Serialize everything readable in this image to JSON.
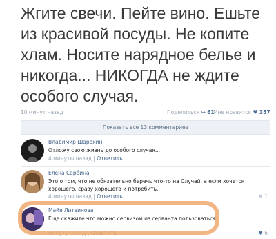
{
  "post": {
    "text": "Жгите свечи. Пейте вино. Ешьте\nиз красивой посуды. Не копите\nхлам. Носите нарядное белье и\nникогда... НИКОГДА не ждите\nособого случая.",
    "time": "10 минут назад",
    "share_label": "Поделиться",
    "share_count": "61",
    "like_label": "Мне нравится",
    "like_count": "357"
  },
  "show_all_comments": "Показать все 13 комментариев",
  "comments": [
    {
      "name": "Владимир Шарохин",
      "text": "Отложу свою жизнь до особого случая...",
      "time": "4 минуты назад",
      "reply": "Ответить",
      "likes": ""
    },
    {
      "name": "Елена Сарбина",
      "text": "Это о том, что не обязательно беречь что-то на Случай, а если хочется хорошего, сразу хорошего и потребить.",
      "time": "4 минуты назад",
      "reply": "Ответить",
      "likes": "1"
    },
    {
      "name": "Майя Литвинова",
      "text": "Еще скажите что можно сервизом из серванта пользоваться",
      "time": "минуту назад",
      "reply": "Ответить",
      "likes": "6"
    }
  ],
  "colors": {
    "link": "#3f5f86",
    "muted": "#9aa5b3",
    "highlight": "#f0a96e"
  }
}
